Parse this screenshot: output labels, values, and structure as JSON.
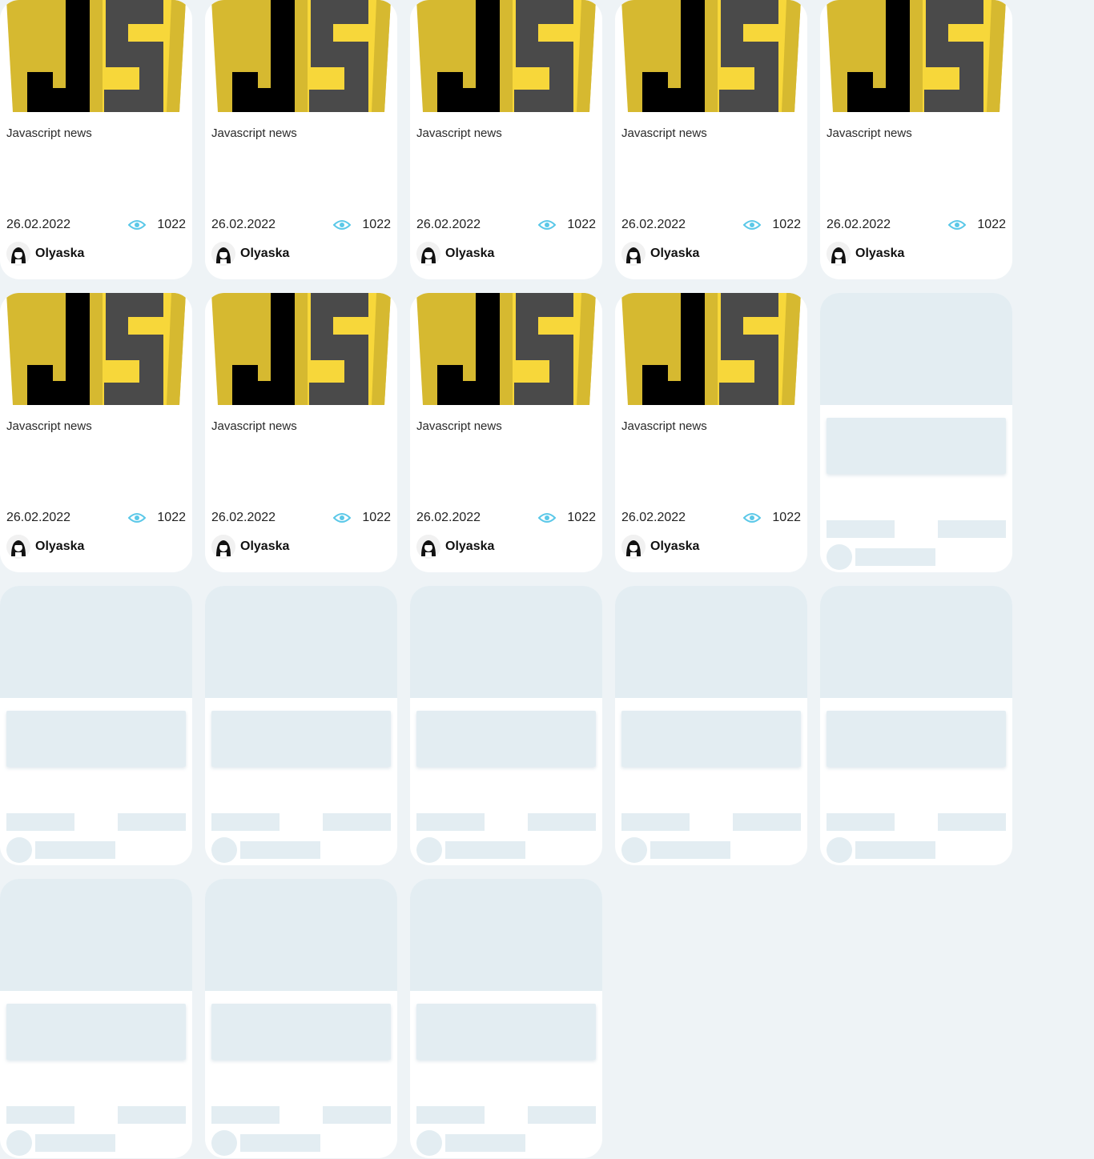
{
  "colors": {
    "page_bg": "#eef3f6",
    "card_bg": "#ffffff",
    "skeleton": "#e3edf2",
    "eye_icon": "#5bc8e8",
    "js_yellow": "#f7d73a",
    "js_dark_yellow": "#d6b930",
    "js_black": "#000000",
    "js_gray": "#4a4a4a"
  },
  "articles": [
    {
      "title": "Javascript news",
      "date": "26.02.2022",
      "views": "1022",
      "author": "Olyaska",
      "cover_icon": "js-logo"
    },
    {
      "title": "Javascript news",
      "date": "26.02.2022",
      "views": "1022",
      "author": "Olyaska",
      "cover_icon": "js-logo"
    },
    {
      "title": "Javascript news",
      "date": "26.02.2022",
      "views": "1022",
      "author": "Olyaska",
      "cover_icon": "js-logo"
    },
    {
      "title": "Javascript news",
      "date": "26.02.2022",
      "views": "1022",
      "author": "Olyaska",
      "cover_icon": "js-logo"
    },
    {
      "title": "Javascript news",
      "date": "26.02.2022",
      "views": "1022",
      "author": "Olyaska",
      "cover_icon": "js-logo"
    },
    {
      "title": "Javascript news",
      "date": "26.02.2022",
      "views": "1022",
      "author": "Olyaska",
      "cover_icon": "js-logo"
    },
    {
      "title": "Javascript news",
      "date": "26.02.2022",
      "views": "1022",
      "author": "Olyaska",
      "cover_icon": "js-logo"
    },
    {
      "title": "Javascript news",
      "date": "26.02.2022",
      "views": "1022",
      "author": "Olyaska",
      "cover_icon": "js-logo"
    },
    {
      "title": "Javascript news",
      "date": "26.02.2022",
      "views": "1022",
      "author": "Olyaska",
      "cover_icon": "js-logo"
    }
  ],
  "skeleton_cards": 9
}
